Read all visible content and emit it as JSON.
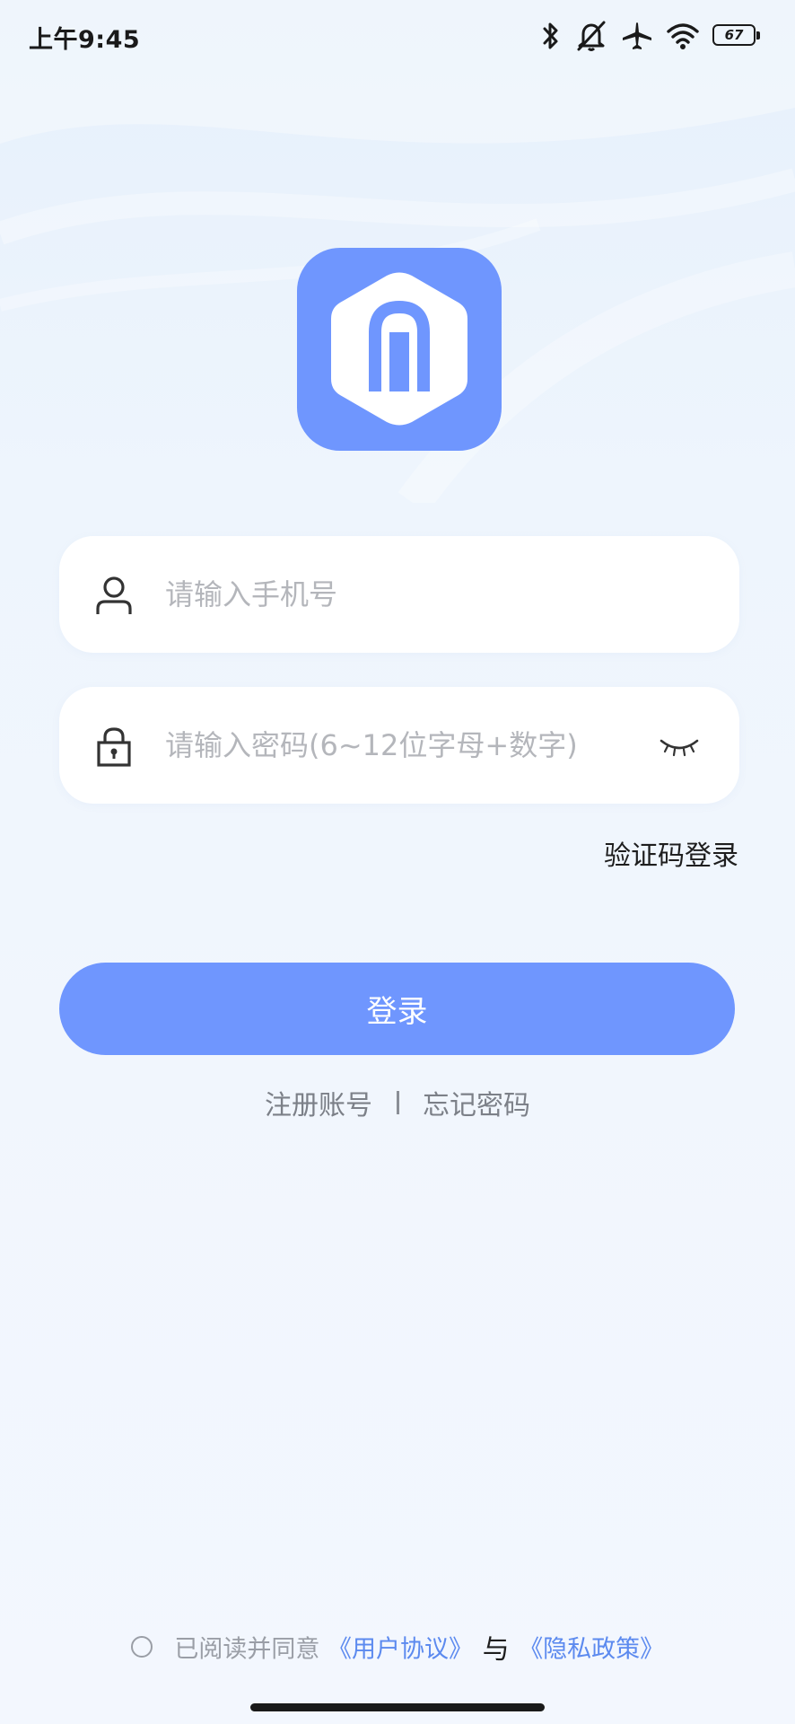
{
  "status_bar": {
    "time": "上午9:45",
    "battery_level": "67",
    "icons": [
      "bluetooth-icon",
      "mute-bell-icon",
      "airplane-icon",
      "wifi-icon",
      "battery-icon"
    ]
  },
  "login_form": {
    "phone_placeholder": "请输入手机号",
    "phone_icon": "user-icon",
    "password_placeholder": "请输入密码(6~12位字母+数字)",
    "password_icon": "lock-icon",
    "password_visibility_icon": "eye-closed-icon",
    "sms_login_label": "验证码登录",
    "login_button_label": "登录",
    "register_label": "注册账号",
    "forgot_password_label": "忘记密码"
  },
  "agreement": {
    "prefix": "已阅读并同意",
    "user_agreement": "《用户协议》",
    "conjunction": "与",
    "privacy_policy": "《隐私政策》",
    "checked": false
  },
  "colors": {
    "primary": "#6f96fe",
    "link": "#5c8aef",
    "background": "#eef5fd",
    "field_background": "#ffffff",
    "placeholder": "#b4b6bb"
  }
}
